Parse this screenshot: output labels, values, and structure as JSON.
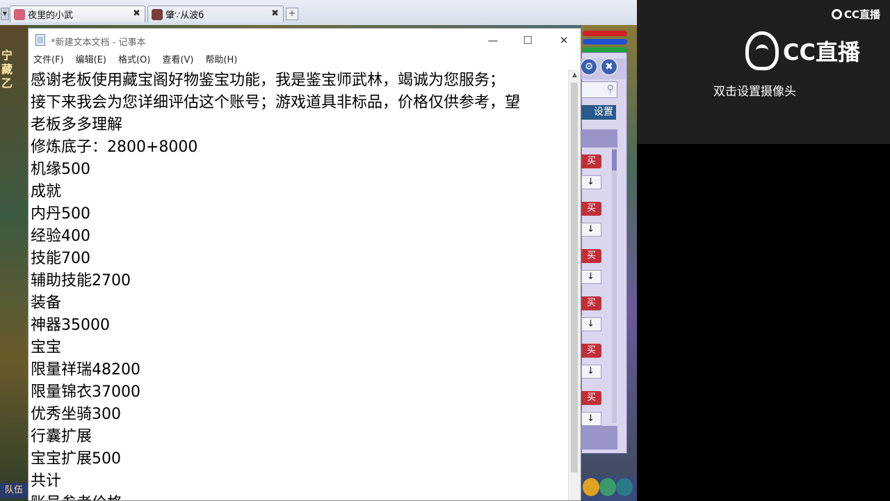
{
  "browser": {
    "tabs": [
      {
        "title": "夜里的小武",
        "close": "✖"
      },
      {
        "title": "肇∵从波б",
        "close": "✖"
      }
    ],
    "scroll_glyph": "▼",
    "add_tab": "+"
  },
  "game": {
    "left_chars": [
      "宁",
      "藏",
      "乙"
    ],
    "team_label": "队伍",
    "panel": {
      "settings_label": "设置",
      "buy_label": "买",
      "down_arrow": "↓",
      "gear_glyph": "⚙",
      "close_glyph": "✖",
      "search_glyph": "⚲"
    }
  },
  "notepad": {
    "title": "*新建文本文档 - 记事本",
    "window_buttons": {
      "minimize": "—",
      "maximize": "☐",
      "close": "✕"
    },
    "menu": [
      "文件(F)",
      "编辑(E)",
      "格式(O)",
      "查看(V)",
      "帮助(H)"
    ],
    "lines": [
      "感谢老板使用藏宝阁好物鉴宝功能，我是鉴宝师武林，竭诚为您服务；",
      "接下来我会为您详细评估这个账号；游戏道具非标品，价格仅供参考，望",
      "老板多多理解",
      "修炼底子：2800+8000",
      "机缘500",
      "成就",
      "内丹500",
      "经验400",
      "技能700",
      "辅助技能2700",
      "装备",
      "神器35000",
      "宝宝",
      "限量祥瑞48200",
      "限量锦衣37000",
      "优秀坐骑300",
      "行囊扩展",
      "宝宝扩展500",
      "共计",
      "账号参考价格"
    ]
  },
  "stream": {
    "corner_brand": "CC直播",
    "logo_brand": "CC直播",
    "camera_hint": "双击设置摄像头"
  }
}
